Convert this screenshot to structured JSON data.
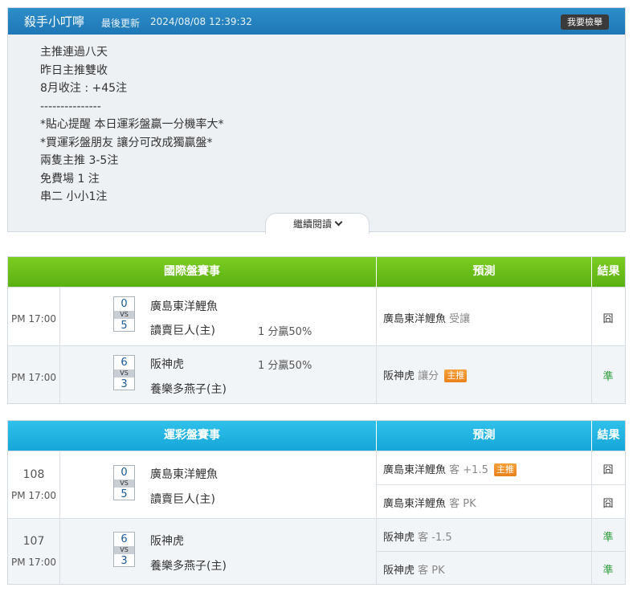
{
  "header": {
    "author": "殺手小叮嚀",
    "updated_label": "最後更新",
    "updated_time": "2024/08/08 12:39:32",
    "report_button": "我要檢舉"
  },
  "post": {
    "lines": [
      "主推連過八天",
      "昨日主推雙收",
      "8月收注 : +45注",
      "---------------",
      "*貼心提醒 本日運彩盤贏一分機率大*",
      "*買運彩盤朋友 讓分可改成獨贏盤*",
      "兩隻主推 3-5注",
      "免費場 1 注",
      "串二 小小1注"
    ],
    "read_more": "繼續閱讀"
  },
  "intl_table": {
    "headers": {
      "match": "國際盤賽事",
      "prediction": "預測",
      "result": "結果"
    },
    "rows": [
      {
        "time": "PM 17:00",
        "away_score": "0",
        "vs": "VS",
        "home_score": "5",
        "away_team": "廣島東洋鯉魚",
        "home_team": "讀賣巨人(主)",
        "odds": "1 分贏50%",
        "pred_team": "廣島東洋鯉魚",
        "pred_pick": "受讓",
        "badge": "",
        "result": "囧",
        "result_type": "lose"
      },
      {
        "time": "PM 17:00",
        "away_score": "6",
        "vs": "VS",
        "home_score": "3",
        "away_team": "阪神虎",
        "home_team": "養樂多燕子(主)",
        "odds": "1 分贏50%",
        "pred_team": "阪神虎",
        "pred_pick": "讓分",
        "badge": "主推",
        "result": "準",
        "result_type": "win"
      }
    ]
  },
  "sports_table": {
    "headers": {
      "match": "運彩盤賽事",
      "prediction": "預測",
      "result": "結果"
    },
    "rows": [
      {
        "num": "108",
        "time": "PM 17:00",
        "away_score": "0",
        "vs": "VS",
        "home_score": "5",
        "away_team": "廣島東洋鯉魚",
        "home_team": "讀賣巨人(主)",
        "preds": [
          {
            "team": "廣島東洋鯉魚",
            "pick": "客 +1.5",
            "badge": "主推",
            "result": "囧",
            "result_type": "lose"
          },
          {
            "team": "廣島東洋鯉魚",
            "pick": "客 PK",
            "badge": "",
            "result": "囧",
            "result_type": "lose"
          }
        ]
      },
      {
        "num": "107",
        "time": "PM 17:00",
        "away_score": "6",
        "vs": "VS",
        "home_score": "3",
        "away_team": "阪神虎",
        "home_team": "養樂多燕子(主)",
        "preds": [
          {
            "team": "阪神虎",
            "pick": "客 -1.5",
            "badge": "",
            "result": "準",
            "result_type": "win"
          },
          {
            "team": "阪神虎",
            "pick": "客 PK",
            "badge": "",
            "result": "準",
            "result_type": "win"
          }
        ]
      }
    ]
  },
  "colors": {
    "header_blue": "#1f77b6",
    "green_header": "#5bb012",
    "cyan_header": "#16a6d8",
    "badge_orange": "#e9811a",
    "win_green": "#2a9a3a"
  }
}
